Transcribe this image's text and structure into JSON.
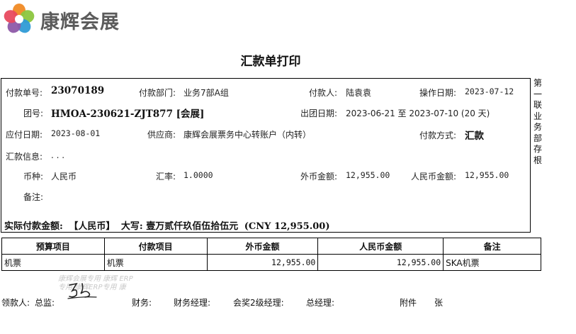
{
  "brand": {
    "name": "康辉会展"
  },
  "title": "汇款单打印",
  "side_label": "第一联业务部存根",
  "info": {
    "payment_no": {
      "label": "付款单号:",
      "value": "23070189"
    },
    "pay_dept": {
      "label": "付款部门:",
      "value": "业务7部A组"
    },
    "payer": {
      "label": "付款人:",
      "value": "陆袁袁"
    },
    "op_date": {
      "label": "操作日期:",
      "value": "2023-07-12"
    },
    "group_no": {
      "label": "团号:",
      "value": "HMOA-230621-ZJT877 [会展]"
    },
    "tour_date": {
      "label": "出团日期:",
      "value": "2023-06-21 至 2023-07-10 (20 天)"
    },
    "due_date": {
      "label": "应付日期:",
      "value": "2023-08-01"
    },
    "supplier": {
      "label": "供应商:",
      "value": "康辉会展票务中心转账户（内转）"
    },
    "pay_method": {
      "label": "付款方式:",
      "value": "汇款"
    },
    "remit_info": {
      "label": "汇款信息:",
      "value": ". . ."
    },
    "currency": {
      "label": "币种:",
      "value": "人民币"
    },
    "rate": {
      "label": "汇率:",
      "value": "1.0000"
    },
    "foreign_amount": {
      "label": "外币金额:",
      "value": "12,955.00"
    },
    "rmb_amount": {
      "label": "人民币金额:",
      "value": "12,955.00"
    },
    "remark": {
      "label": "备注:",
      "value": ""
    }
  },
  "actual": {
    "label": "实际付款金额:",
    "currency": "【人民币】",
    "capital_label": "大写:",
    "capital": "壹万贰仟玖佰伍拾伍元",
    "cny": "(CNY 12,955.00)"
  },
  "table": {
    "headers": [
      "预算项目",
      "付款项目",
      "外币金额",
      "人民币金额",
      "备注"
    ],
    "rows": [
      [
        "机票",
        "机票",
        "12,955.00",
        "12,955.00",
        "SKA机票"
      ]
    ]
  },
  "watermark": "康辉会展专用 康辉 ERP专用 康辉ERP专用 康",
  "footer": {
    "receiver": "领款人:",
    "supervisor": "总监:",
    "finance": "财务:",
    "finance_manager": "财务经理:",
    "level2_manager": "会奖2级经理:",
    "general_manager": "总经理:",
    "attachment": "附件",
    "sheets": "张"
  },
  "colors": {
    "logo_orange": "#f08a24",
    "logo_green": "#8cc63f",
    "logo_blue": "#2f9bd6",
    "logo_purple": "#8e5aa8",
    "logo_red": "#e84a5f",
    "brand_text": "#5b5b5b"
  }
}
